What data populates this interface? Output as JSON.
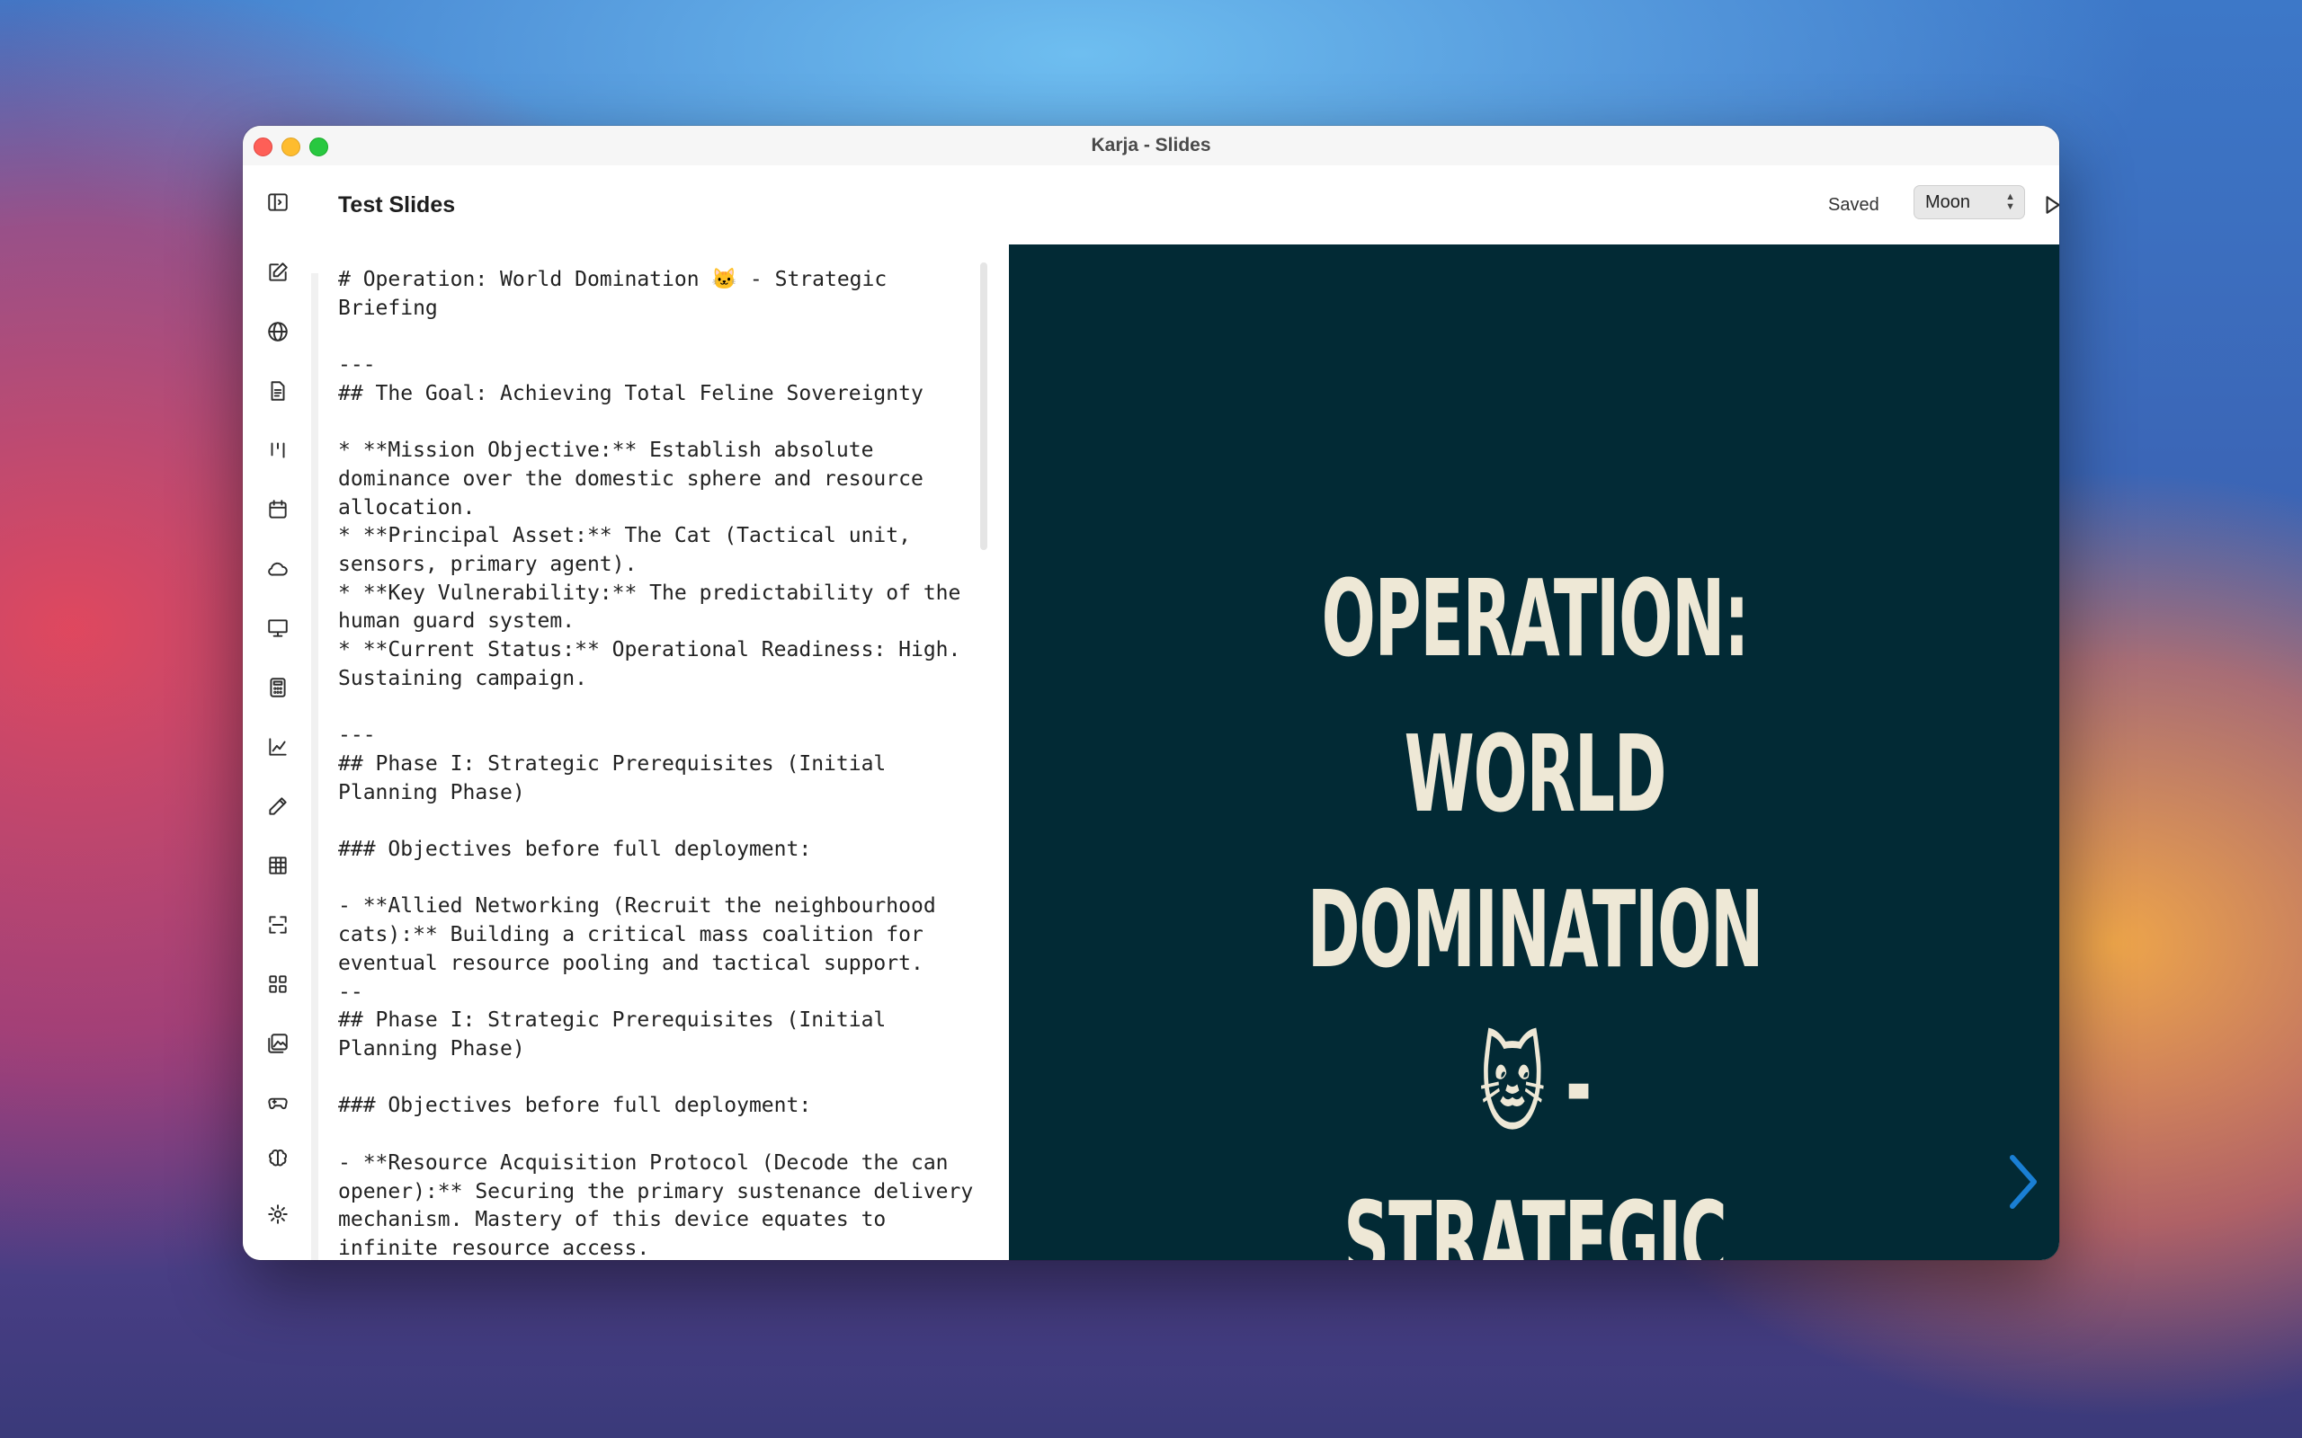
{
  "window": {
    "title": "Karja - Slides"
  },
  "header": {
    "doc_title": "Test Slides",
    "status": "Saved",
    "theme": "Moon"
  },
  "sidebar": {
    "icons": [
      "sidebar-toggle-icon",
      "edit-note-icon",
      "globe-icon",
      "document-icon",
      "kanban-icon",
      "calendar-icon",
      "cloud-icon",
      "presentation-icon",
      "calculator-icon",
      "chart-icon",
      "pencil-icon",
      "table-icon",
      "scan-icon",
      "grid-icon",
      "images-icon",
      "gamepad-icon",
      "brain-icon",
      "gear-icon"
    ]
  },
  "editor": {
    "content": "# Operation: World Domination 🐱 - Strategic Briefing\n\n---\n## The Goal: Achieving Total Feline Sovereignty\n\n* **Mission Objective:** Establish absolute dominance over the domestic sphere and resource allocation.\n* **Principal Asset:** The Cat (Tactical unit, sensors, primary agent).\n* **Key Vulnerability:** The predictability of the human guard system.\n* **Current Status:** Operational Readiness: High. Sustaining campaign.\n\n---\n## Phase I: Strategic Prerequisites (Initial Planning Phase)\n\n### Objectives before full deployment:\n\n- **Allied Networking (Recruit the neighbourhood cats):** Building a critical mass coalition for eventual resource pooling and tactical support.\n--\n## Phase I: Strategic Prerequisites (Initial Planning Phase)\n\n### Objectives before full deployment:\n\n- **Resource Acquisition Protocol (Decode the can opener):** Securing the primary sustenance delivery mechanism. Mastery of this device equates to infinite resource access.\n--\n## Phase I: Strategic Prerequisites (Initial Planning"
  },
  "preview": {
    "slide_title": "OPERATION: WORLD DOMINATION 🐱 - STRATEGIC BRIEFING",
    "background": "#022a35",
    "text_color": "#eee8d6",
    "accent": "#1a7fd4"
  }
}
